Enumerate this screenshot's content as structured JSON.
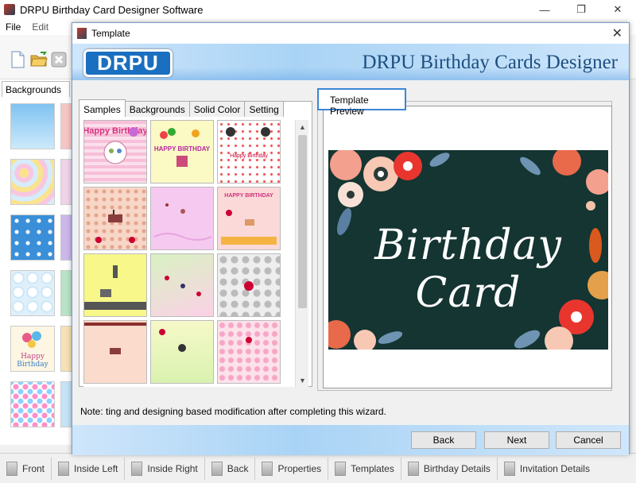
{
  "app": {
    "title": "DRPU Birthday Card Designer Software",
    "window_buttons": [
      "—",
      "❐",
      "✕"
    ],
    "menu": [
      "File",
      "Edit"
    ],
    "left_panel_tab": "Backgrounds",
    "bottom_bar": [
      "Front",
      "Inside Left",
      "Inside Right",
      "Back",
      "Properties",
      "Templates",
      "Birthday Details",
      "Invitation Details"
    ]
  },
  "dialog": {
    "title": "Template",
    "close_glyph": "✕",
    "logo": "DRPU",
    "banner_title": "DRPU Birthday Cards Designer",
    "tabs": [
      "Samples",
      "Backgrounds",
      "Solid Color",
      "Setting"
    ],
    "active_tab": "Samples",
    "preview_label": "Template Preview",
    "preview_card_text": "Birthday Card",
    "templates": [
      {
        "caption": "Happy Birthday"
      },
      {
        "caption": "HAPPY BIRTHDAY"
      },
      {
        "caption": "Happy Birthday"
      },
      {
        "caption": ""
      },
      {
        "caption": ""
      },
      {
        "caption": "HAPPY BIRTHDAY"
      },
      {
        "caption": ""
      },
      {
        "caption": ""
      },
      {
        "caption": ""
      },
      {
        "caption": ""
      },
      {
        "caption": ""
      },
      {
        "caption": ""
      }
    ],
    "note": "Note: ting and designing based modification after completing this wizard.",
    "buttons": {
      "back": "Back",
      "next": "Next",
      "cancel": "Cancel"
    },
    "scroll_up": "▲",
    "scroll_down": "▼"
  },
  "colors": {
    "banner_title": "#1d4f80",
    "logo_bg": "#1a6fc0",
    "card_bg": "#143532",
    "focus_border": "#3b86d6"
  }
}
